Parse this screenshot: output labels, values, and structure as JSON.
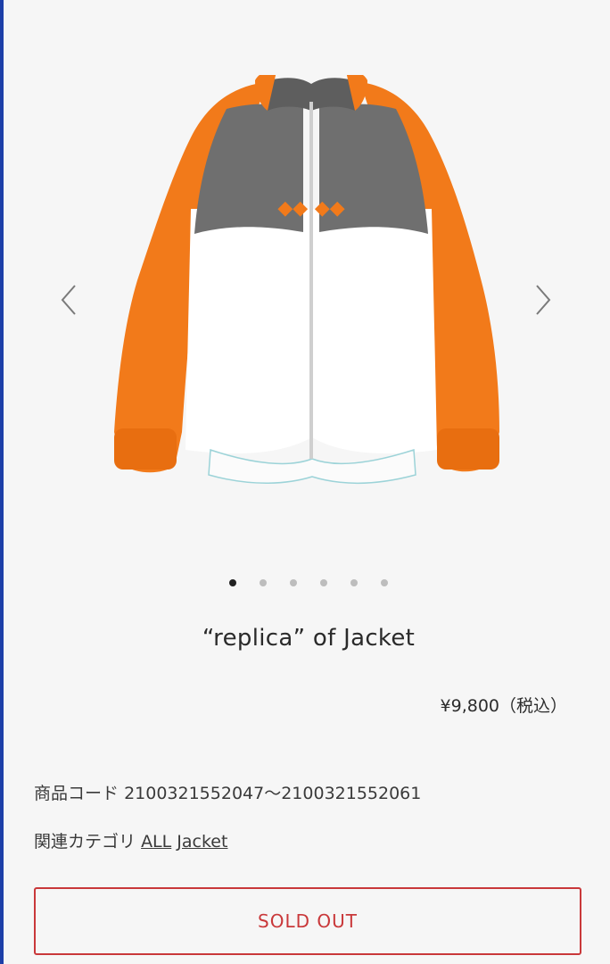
{
  "carousel": {
    "prev_icon": "chevron-left-icon",
    "next_icon": "chevron-right-icon",
    "image_subject": "jacket-photo",
    "slide_count": 6,
    "active_slide": 1
  },
  "product": {
    "title": "“replica” of Jacket",
    "price": "¥9,800（税込）",
    "code_label": "商品コード",
    "code_value": "2100321552047〜2100321552061",
    "category_label": "関連カテゴリ",
    "categories": [
      "ALL",
      "Jacket"
    ]
  },
  "actions": {
    "sold_out_label": "SOLD OUT"
  },
  "colors": {
    "accent_red": "#c9383a",
    "jacket_orange": "#f27a1a",
    "jacket_gray": "#6f6f6f",
    "jacket_white": "#ffffff",
    "left_border_blue": "#1d3fa8"
  }
}
